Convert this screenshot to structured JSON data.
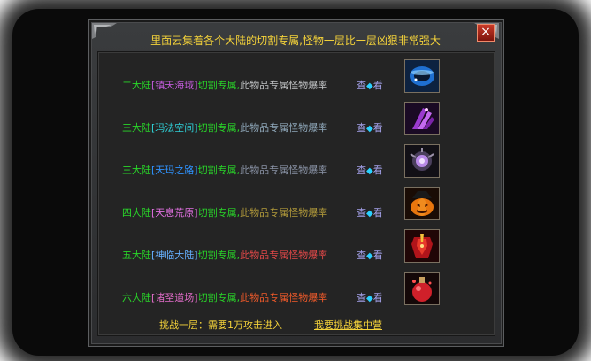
{
  "title": "里面云集着各个大陆的切割专属,怪物一层比一层凶狠非常强大",
  "close_label": "×",
  "rows": [
    {
      "continent": "二大陆",
      "location": "[镇天海域]",
      "suffix": "切割专属,",
      "desc": "此物品专属怪物爆率",
      "view": "查",
      "view2": "看",
      "icon": "blue-bracelet-icon"
    },
    {
      "continent": "三大陆",
      "location": "[玛法空间]",
      "suffix": "切割专属,",
      "desc": "此物品专属怪物爆率",
      "view": "查",
      "view2": "看",
      "icon": "purple-claw-icon"
    },
    {
      "continent": "三大陆",
      "location": "[天玛之路]",
      "suffix": "切割专属,",
      "desc": "此物品专属怪物爆率",
      "view": "查",
      "view2": "看",
      "icon": "purple-orb-icon"
    },
    {
      "continent": "四大陆",
      "location": "[天息荒原]",
      "suffix": "切割专属,",
      "desc": "此物品专属怪物爆率",
      "view": "查",
      "view2": "看",
      "icon": "pumpkin-icon"
    },
    {
      "continent": "五大陆",
      "location": "[神临大陆]",
      "suffix": "切割专属,",
      "desc": "此物品专属怪物爆率",
      "view": "查",
      "view2": "看",
      "icon": "red-armor-icon"
    },
    {
      "continent": "六大陆",
      "location": "[诸圣道场]",
      "suffix": "切割专属,",
      "desc": "此物品专属怪物爆率",
      "view": "查",
      "view2": "看",
      "icon": "red-potion-icon"
    }
  ],
  "footer": {
    "requirement": "挑战一层：需要1万攻击进入",
    "challenge_link": "我要挑战集中营"
  },
  "colors": {
    "title": "#f4d23a",
    "continent": "#29d629",
    "close_button": "#c83a28"
  }
}
